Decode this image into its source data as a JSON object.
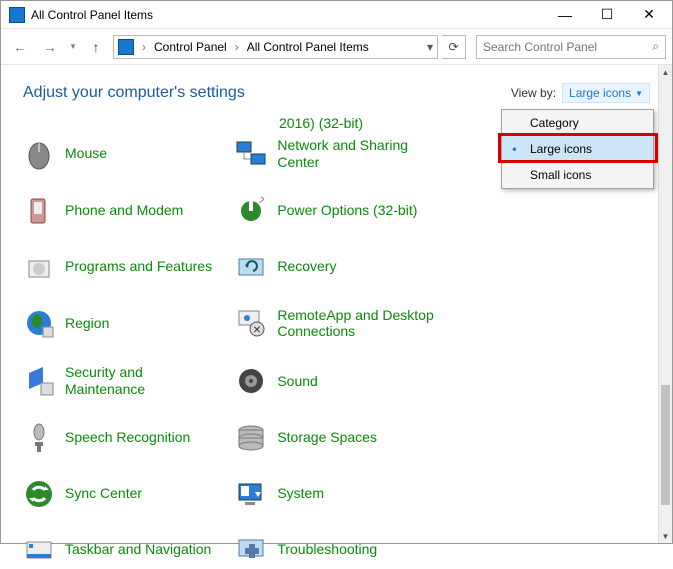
{
  "titlebar": {
    "title": "All Control Panel Items"
  },
  "nav": {
    "breadcrumb": [
      "Control Panel",
      "All Control Panel Items"
    ],
    "search_placeholder": "Search Control Panel"
  },
  "header": {
    "heading": "Adjust your computer's settings",
    "viewby_label": "View by:",
    "viewby_value": "Large icons"
  },
  "cutoff_text": "2016) (32-bit)",
  "dropdown": {
    "items": [
      "Category",
      "Large icons",
      "Small icons"
    ],
    "selected_index": 1
  },
  "items_col1": [
    "Mouse",
    "Phone and Modem",
    "Programs and Features",
    "Region",
    "Security and Maintenance",
    "Speech Recognition",
    "Sync Center",
    "Taskbar and Navigation"
  ],
  "items_col2": [
    "Network and Sharing Center",
    "Power Options (32-bit)",
    "Recovery",
    "RemoteApp and Desktop Connections",
    "Sound",
    "Storage Spaces",
    "System",
    "Troubleshooting"
  ],
  "icons_col1": [
    "mouse",
    "phone",
    "programs",
    "region",
    "security",
    "speech",
    "sync",
    "taskbar"
  ],
  "icons_col2": [
    "network",
    "power",
    "recovery",
    "remote",
    "sound",
    "storage",
    "system",
    "trouble"
  ]
}
